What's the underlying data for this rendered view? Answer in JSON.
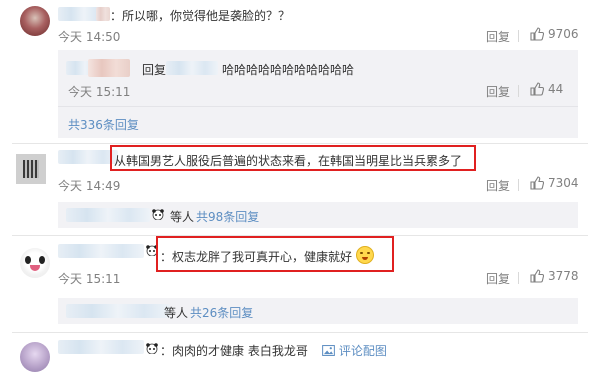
{
  "comments": [
    {
      "text": "：所以哪，你觉得他是袭脸的？？",
      "time": "今天 14:50",
      "reply": "回复",
      "likes": "9706",
      "sub_reply": {
        "prefix": "回复",
        "text": "哈哈哈哈哈哈哈哈哈哈哈",
        "time": "今天 15:11",
        "reply": "回复",
        "likes": "44"
      },
      "more_replies": "共336条回复"
    },
    {
      "text": "从韩国男艺人服役后普遍的状态来看，在韩国当明星比当兵累多了",
      "time": "今天 14:49",
      "reply": "回复",
      "likes": "7304",
      "thread_suffix": "等人",
      "more_replies": "共98条回复"
    },
    {
      "text": "：权志龙胖了我可真开心，健康就好",
      "time": "今天 15:11",
      "reply": "回复",
      "likes": "3778",
      "thread_suffix": "等人",
      "more_replies": "共26条回复"
    },
    {
      "text": "：肉肉的才健康 表白我龙哥",
      "image_link": "评论配图"
    }
  ],
  "icons": {
    "like": "thumbs-up-icon",
    "image": "image-icon",
    "emoji": "sweat-smile-emoji-icon",
    "panda": "panda-emoji-icon"
  },
  "colors": {
    "username": "#eb7350",
    "link": "#5d8ec2",
    "highlight_box": "#e02020",
    "meta_text": "#808080",
    "panel_bg": "#f2f2f5"
  }
}
